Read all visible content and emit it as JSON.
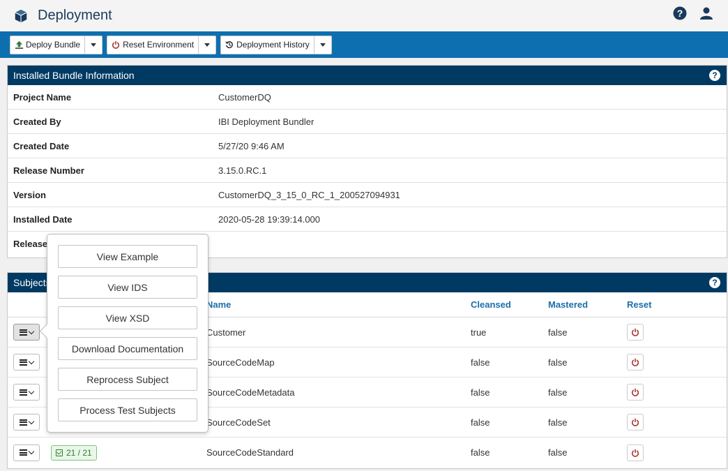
{
  "app": {
    "title": "Deployment"
  },
  "colors": {
    "toolbar": "#0e6fb0",
    "panel_header": "#003a63",
    "header_link": "#1a6fa8",
    "reset_icon": "#a5352b"
  },
  "toolbar": {
    "buttons": [
      {
        "label": "Deploy Bundle",
        "icon": "deploy-icon"
      },
      {
        "label": "Reset Environment",
        "icon": "power-icon"
      },
      {
        "label": "Deployment History",
        "icon": "history-icon"
      }
    ]
  },
  "installed": {
    "title": "Installed Bundle Information",
    "rows": [
      {
        "label": "Project Name",
        "value": "CustomerDQ"
      },
      {
        "label": "Created By",
        "value": "IBI Deployment Bundler"
      },
      {
        "label": "Created Date",
        "value": "5/27/20 9:46 AM"
      },
      {
        "label": "Release Number",
        "value": "3.15.0.RC.1"
      },
      {
        "label": "Version",
        "value": "CustomerDQ_3_15_0_RC_1_200527094931"
      },
      {
        "label": "Installed Date",
        "value": "2020-05-28 19:39:14.000"
      },
      {
        "label": "Release",
        "value": ""
      }
    ]
  },
  "subjects": {
    "title": "Subjects",
    "columns": {
      "name": "Name",
      "cleansed": "Cleansed",
      "mastered": "Mastered",
      "reset": "Reset"
    },
    "rows": [
      {
        "name": "Customer",
        "cleansed": "true",
        "mastered": "false",
        "badge": ""
      },
      {
        "name": "SourceCodeMap",
        "cleansed": "false",
        "mastered": "false",
        "badge": ""
      },
      {
        "name": "SourceCodeMetadata",
        "cleansed": "false",
        "mastered": "false",
        "badge": ""
      },
      {
        "name": "SourceCodeSet",
        "cleansed": "false",
        "mastered": "false",
        "badge": ""
      },
      {
        "name": "SourceCodeStandard",
        "cleansed": "false",
        "mastered": "false",
        "badge": "21 / 21"
      }
    ]
  },
  "popover": {
    "items": [
      "View Example",
      "View IDS",
      "View XSD",
      "Download Documentation",
      "Reprocess Subject",
      "Process Test Subjects"
    ]
  }
}
